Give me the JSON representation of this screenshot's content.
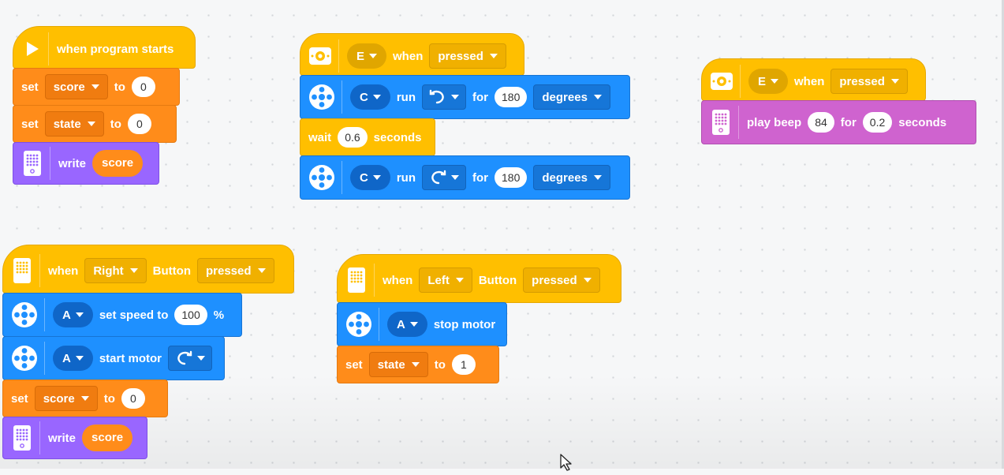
{
  "stack1": {
    "hat": "when program starts",
    "set1": {
      "label": "set",
      "var": "score",
      "to": "to",
      "value": "0"
    },
    "set2": {
      "label": "set",
      "var": "state",
      "to": "to",
      "value": "0"
    },
    "write": {
      "label": "write",
      "value": "score"
    }
  },
  "stack2": {
    "port": "E",
    "when": "when",
    "event": "pressed",
    "run1": {
      "port": "C",
      "run": "run",
      "for": "for",
      "value": "180",
      "unit": "degrees"
    },
    "wait": {
      "label": "wait",
      "value": "0.6",
      "unit": "seconds"
    },
    "run2": {
      "port": "C",
      "run": "run",
      "for": "for",
      "value": "180",
      "unit": "degrees"
    }
  },
  "stack3": {
    "port": "E",
    "when": "when",
    "event": "pressed",
    "beep": {
      "label": "play beep",
      "note": "84",
      "for": "for",
      "value": "0.2",
      "unit": "seconds"
    }
  },
  "stack4": {
    "when": "when",
    "button": "Right",
    "button_label": "Button",
    "event": "pressed",
    "speed": {
      "port": "A",
      "label": "set speed to",
      "value": "100",
      "unit": "%"
    },
    "start": {
      "port": "A",
      "label": "start motor"
    },
    "set": {
      "label": "set",
      "var": "score",
      "to": "to",
      "value": "0"
    },
    "write": {
      "label": "write",
      "value": "score"
    }
  },
  "stack5": {
    "when": "when",
    "button": "Left",
    "button_label": "Button",
    "event": "pressed",
    "stop": {
      "port": "A",
      "label": "stop motor"
    },
    "set": {
      "label": "set",
      "var": "state",
      "to": "to",
      "value": "1"
    }
  },
  "icons": [
    "play-icon",
    "color-sensor-icon",
    "motor-icon",
    "hub-display-icon",
    "rotate-ccw-icon",
    "rotate-cw-icon"
  ],
  "colors": {
    "events": "#ffbf00",
    "variables": "#ff8c1a",
    "motors": "#1e90ff",
    "display": "#9966ff",
    "sound": "#cf63cf"
  }
}
